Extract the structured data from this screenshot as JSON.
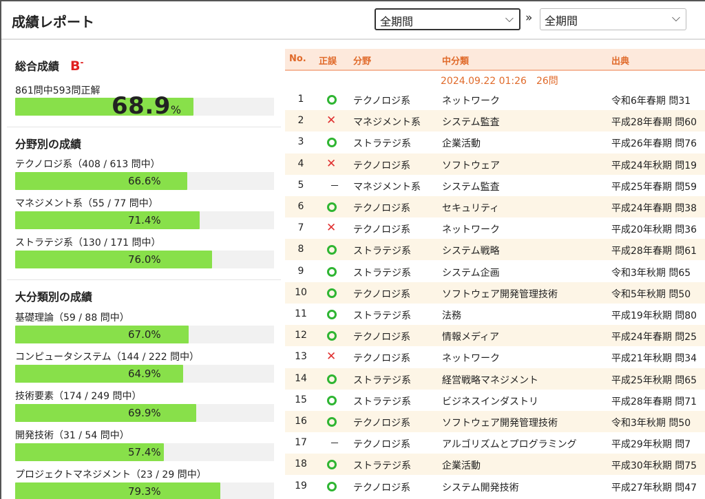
{
  "header": {
    "title": "成績レポート",
    "period_from": "全期間",
    "period_to": "全期間",
    "separator": "»"
  },
  "overall": {
    "heading": "総合成績",
    "grade": "B",
    "grade_mod": "-",
    "summary": "861問中593問正解",
    "percent": 68.9,
    "percent_num": "68.9",
    "percent_unit": "%"
  },
  "field": {
    "heading": "分野別の成績",
    "items": [
      {
        "label": "テクノロジ系（408 / 613 問中）",
        "pct": "66.6%",
        "value": 66.6
      },
      {
        "label": "マネジメント系（55 / 77 問中）",
        "pct": "71.4%",
        "value": 71.4
      },
      {
        "label": "ストラテジ系（130 / 171 問中）",
        "pct": "76.0%",
        "value": 76.0
      }
    ]
  },
  "major": {
    "heading": "大分類別の成績",
    "items": [
      {
        "label": "基礎理論（59 / 88 問中）",
        "pct": "67.0%",
        "value": 67.0
      },
      {
        "label": "コンピュータシステム（144 / 222 問中）",
        "pct": "64.9%",
        "value": 64.9
      },
      {
        "label": "技術要素（174 / 249 問中）",
        "pct": "69.9%",
        "value": 69.9
      },
      {
        "label": "開発技術（31 / 54 問中）",
        "pct": "57.4%",
        "value": 57.4
      },
      {
        "label": "プロジェクトマネジメント（23 / 29 問中）",
        "pct": "79.3%",
        "value": 79.3
      }
    ]
  },
  "table": {
    "headers": {
      "no": "No.",
      "result": "正誤",
      "field": "分野",
      "category": "中分類",
      "source": "出典"
    },
    "session": "2024.09.22 01:26　26問",
    "rows": [
      {
        "no": "1",
        "result": "ok",
        "field": "テクノロジ系",
        "category": "ネットワーク",
        "source": "令和6年春期 問31"
      },
      {
        "no": "2",
        "result": "ng",
        "field": "マネジメント系",
        "category": "システム監査",
        "source": "平成28年春期 問60"
      },
      {
        "no": "3",
        "result": "ok",
        "field": "ストラテジ系",
        "category": "企業活動",
        "source": "平成26年春期 問76"
      },
      {
        "no": "4",
        "result": "ng",
        "field": "テクノロジ系",
        "category": "ソフトウェア",
        "source": "平成24年秋期 問19"
      },
      {
        "no": "5",
        "result": "na",
        "field": "マネジメント系",
        "category": "システム監査",
        "source": "平成25年春期 問59"
      },
      {
        "no": "6",
        "result": "ok",
        "field": "テクノロジ系",
        "category": "セキュリティ",
        "source": "平成24年春期 問38"
      },
      {
        "no": "7",
        "result": "ng",
        "field": "テクノロジ系",
        "category": "ネットワーク",
        "source": "平成20年秋期 問36"
      },
      {
        "no": "8",
        "result": "ok",
        "field": "ストラテジ系",
        "category": "システム戦略",
        "source": "平成28年春期 問61"
      },
      {
        "no": "9",
        "result": "ok",
        "field": "ストラテジ系",
        "category": "システム企画",
        "source": "令和3年秋期 問65"
      },
      {
        "no": "10",
        "result": "ok",
        "field": "テクノロジ系",
        "category": "ソフトウェア開発管理技術",
        "source": "令和5年秋期 問50"
      },
      {
        "no": "11",
        "result": "ok",
        "field": "ストラテジ系",
        "category": "法務",
        "source": "平成19年秋期 問80"
      },
      {
        "no": "12",
        "result": "ok",
        "field": "テクノロジ系",
        "category": "情報メディア",
        "source": "平成24年春期 問25"
      },
      {
        "no": "13",
        "result": "ng",
        "field": "テクノロジ系",
        "category": "ネットワーク",
        "source": "平成21年秋期 問34"
      },
      {
        "no": "14",
        "result": "ok",
        "field": "ストラテジ系",
        "category": "経営戦略マネジメント",
        "source": "平成25年秋期 問65"
      },
      {
        "no": "15",
        "result": "ok",
        "field": "ストラテジ系",
        "category": "ビジネスインダストリ",
        "source": "平成28年春期 問71"
      },
      {
        "no": "16",
        "result": "ok",
        "field": "テクノロジ系",
        "category": "ソフトウェア開発管理技術",
        "source": "令和3年秋期 問50"
      },
      {
        "no": "17",
        "result": "na",
        "field": "テクノロジ系",
        "category": "アルゴリズムとプログラミング",
        "source": "平成29年秋期 問7"
      },
      {
        "no": "18",
        "result": "ok",
        "field": "ストラテジ系",
        "category": "企業活動",
        "source": "平成30年秋期 問75"
      },
      {
        "no": "19",
        "result": "ok",
        "field": "テクノロジ系",
        "category": "システム開発技術",
        "source": "平成27年秋期 問47"
      }
    ],
    "marks": {
      "na": "－",
      "ng": "✕"
    }
  },
  "colors": {
    "bar_fill": "#88e04a",
    "accent": "#e06a2a",
    "ok": "#2fb532",
    "ng": "#e03030",
    "grade": "#e02020"
  }
}
